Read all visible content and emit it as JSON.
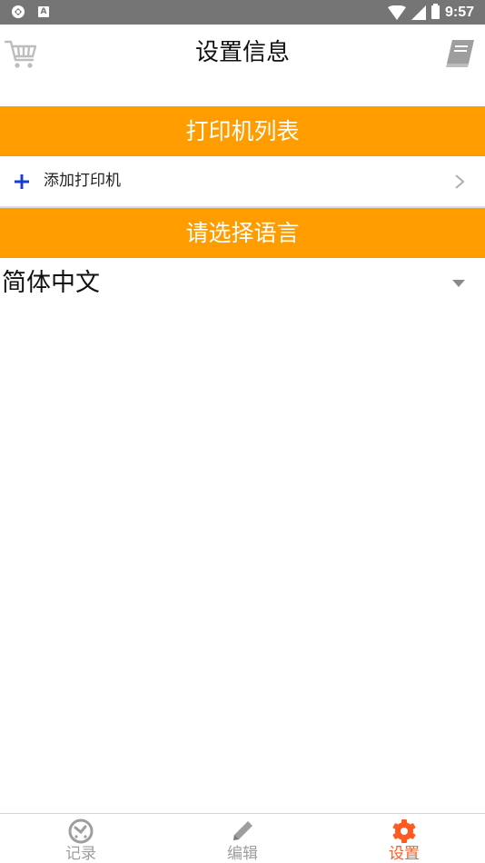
{
  "status_bar": {
    "time": "9:57",
    "left_icons": [
      "sync-icon",
      "a-badge-icon"
    ],
    "right_icons": [
      "wifi-icon",
      "signal-icon",
      "battery-icon"
    ],
    "badge_letter": "A"
  },
  "header": {
    "title": "设置信息",
    "left_icon": "cart-icon",
    "right_icon": "book-icon"
  },
  "sections": {
    "printers_title": "打印机列表",
    "add_printer_label": "添加打印机",
    "language_title": "请选择语言",
    "language_value": "简体中文"
  },
  "bottom_nav": {
    "items": [
      {
        "label": "记录",
        "icon": "history-icon",
        "active": false
      },
      {
        "label": "编辑",
        "icon": "pencil-icon",
        "active": false
      },
      {
        "label": "设置",
        "icon": "gear-icon",
        "active": true
      }
    ]
  },
  "colors": {
    "accent": "#ff9d00",
    "active_tab": "#ff5a1f",
    "inactive_tab": "#9e9e9e",
    "status_bar": "#757575"
  }
}
